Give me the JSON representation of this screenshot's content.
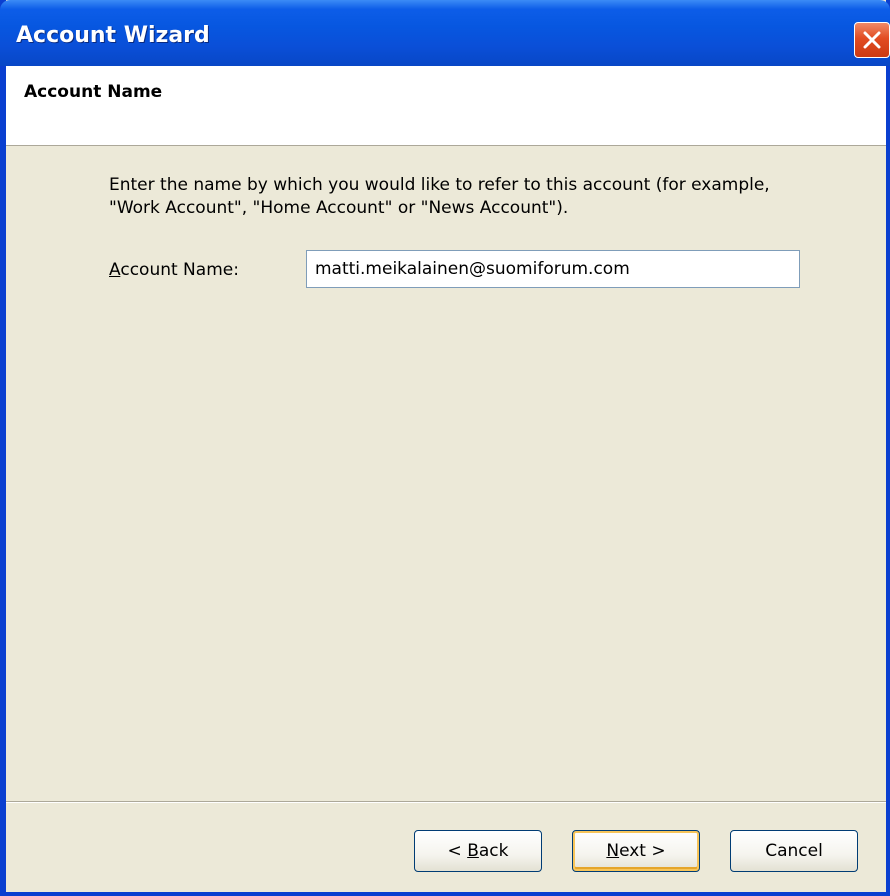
{
  "window": {
    "title": "Account Wizard",
    "close_icon": "close-icon",
    "title_color": "#0a4fd8",
    "close_color": "#e24c22"
  },
  "page": {
    "heading": "Account Name",
    "description": "Enter the name by which you would like to refer to this account (for example, \"Work Account\", \"Home Account\" or \"News Account\").",
    "field": {
      "label_accel": "A",
      "label_rest": "ccount Name:",
      "value": "matti.meikalainen@suomiforum.com"
    }
  },
  "buttons": {
    "back": {
      "prefix": "< ",
      "accel": "B",
      "rest": "ack"
    },
    "next": {
      "accel": "N",
      "rest": "ext >"
    },
    "cancel": {
      "label": "Cancel"
    }
  }
}
